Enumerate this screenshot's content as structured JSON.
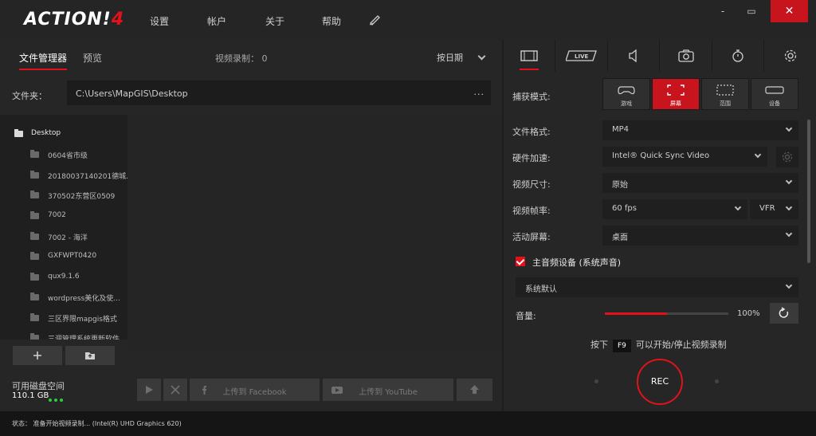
{
  "app": {
    "logo_main": "ACTION!",
    "logo_num": "4"
  },
  "menu": {
    "settings": "设置",
    "account": "帐户",
    "about": "关于",
    "help": "帮助"
  },
  "window_controls": {
    "minimize": "-",
    "maximize": "▭",
    "close": "✕"
  },
  "left": {
    "tab_file_manager": "文件管理器",
    "tab_preview": "预览",
    "video_count_label": "视频录制：",
    "video_count_value": "0",
    "sort_label": "按日期",
    "folder_label": "文件夹：",
    "folder_path": "C:\\Users\\MapGIS\\Desktop",
    "folder_more": "...",
    "tree": {
      "root": "Desktop",
      "children": [
        "0604省市级",
        "20180037140201德城...",
        "370502东营区0509",
        "7002",
        "7002 - 海洋",
        "GXFWPT0420",
        "qux9.1.6",
        "wordpress美化及使...",
        "三区界限mapgis格式",
        "三调管理系统更新软件"
      ]
    },
    "disk_label": "可用磁盘空间",
    "disk_value": "110.1 GB",
    "upload_facebook": "上传到 Facebook",
    "upload_youtube": "上传到 YouTube"
  },
  "right": {
    "capture_mode_label": "捕获模式:",
    "capture_modes": [
      "游戏",
      "屏幕",
      "范围",
      "设备"
    ],
    "file_format_label": "文件格式:",
    "file_format_value": "MP4",
    "hw_accel_label": "硬件加速:",
    "hw_accel_value": "Intel® Quick Sync Video",
    "video_size_label": "视频尺寸:",
    "video_size_value": "原始",
    "frame_rate_label": "视频帧率:",
    "frame_rate_value": "60 fps",
    "frame_mode_value": "VFR",
    "active_screen_label": "活动屏幕:",
    "active_screen_value": "桌面",
    "main_audio_label": "主音频设备 (系统声音)",
    "audio_device_value": "系统默认",
    "volume_label": "音量:",
    "volume_percent": "100%",
    "volume_fraction": 0.5,
    "hotkey_prefix": "按下",
    "hotkey_key": "F9",
    "hotkey_suffix": "可以开始/停止视频录制",
    "rec_label": "REC",
    "live_tab_label": "LIVE"
  },
  "status": {
    "text": "状态：    准备开始视频录制...  (Intel(R) UHD Graphics 620)"
  },
  "colors": {
    "accent": "#e1121b",
    "background": "#262626"
  }
}
